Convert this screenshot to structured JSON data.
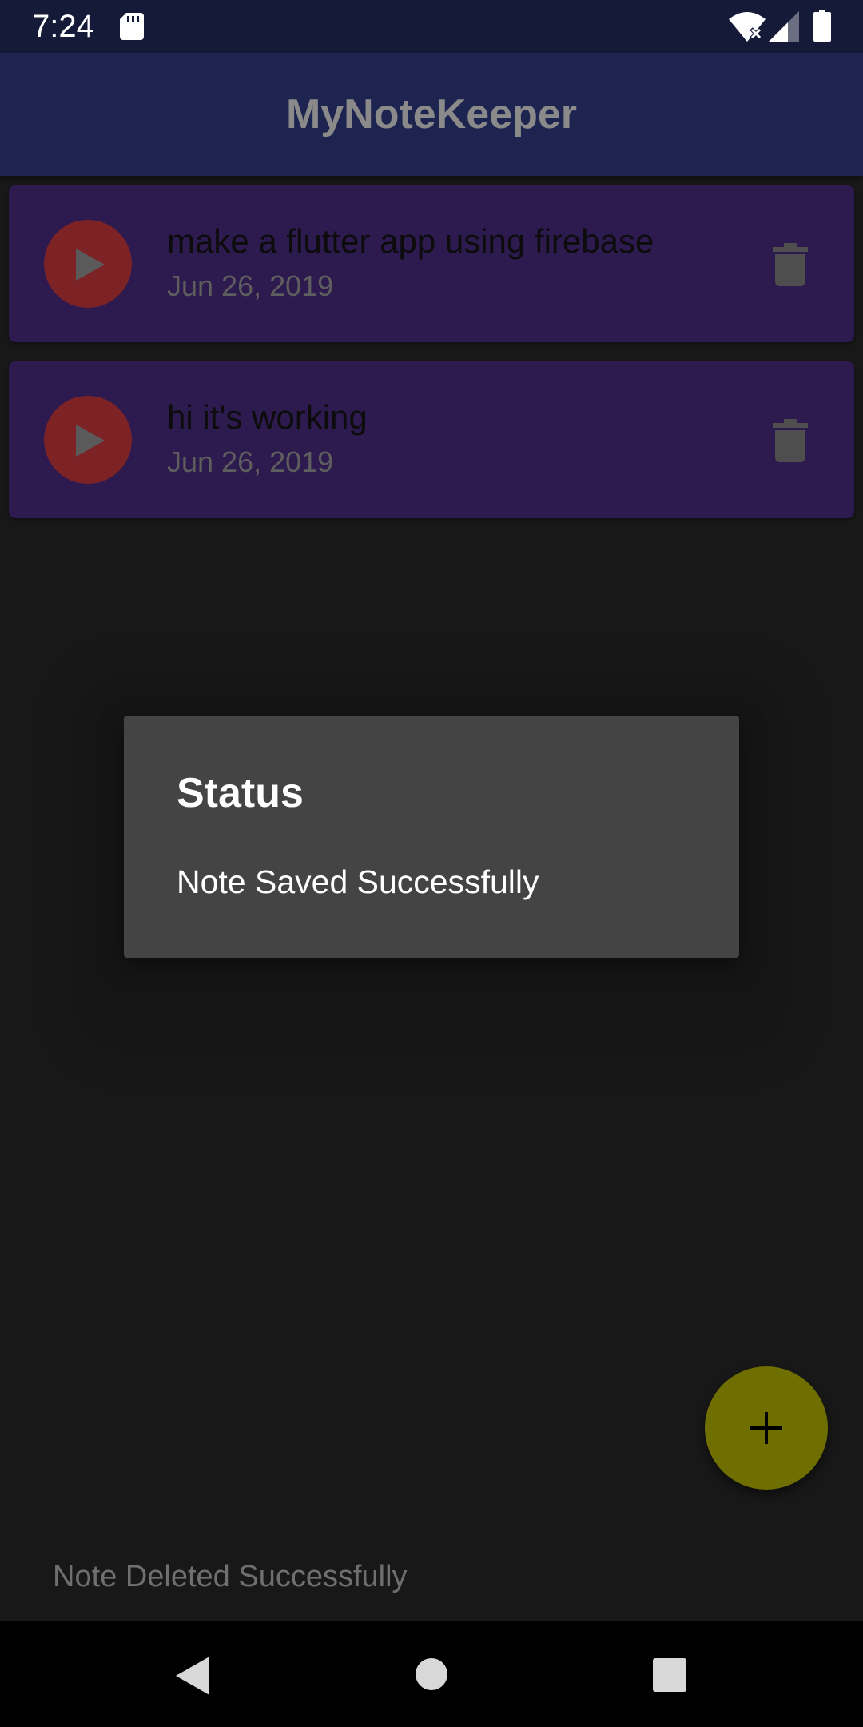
{
  "status_bar": {
    "time": "7:24"
  },
  "app_bar": {
    "title": "MyNoteKeeper"
  },
  "notes": [
    {
      "title": "make a flutter app using firebase",
      "date": "Jun 26, 2019",
      "priority_icon": "play-arrow-icon",
      "delete_icon": "trash-icon"
    },
    {
      "title": "hi it's working",
      "date": "Jun 26, 2019",
      "priority_icon": "play-arrow-icon",
      "delete_icon": "trash-icon"
    }
  ],
  "dialog": {
    "title": "Status",
    "message": "Note Saved Successfully"
  },
  "fab": {
    "icon": "plus-icon"
  },
  "snackbar": {
    "text": "Note Deleted Successfully"
  },
  "nav_bar": {
    "icons": [
      "back-icon",
      "home-icon",
      "recents-icon"
    ]
  },
  "colors": {
    "status_bar": "#141a38",
    "app_bar": "#1e2450",
    "card": "#2d1a4f",
    "avatar": "#7d2326",
    "fab": "#6f6e00",
    "dialog": "#444444",
    "background": "#181818"
  }
}
